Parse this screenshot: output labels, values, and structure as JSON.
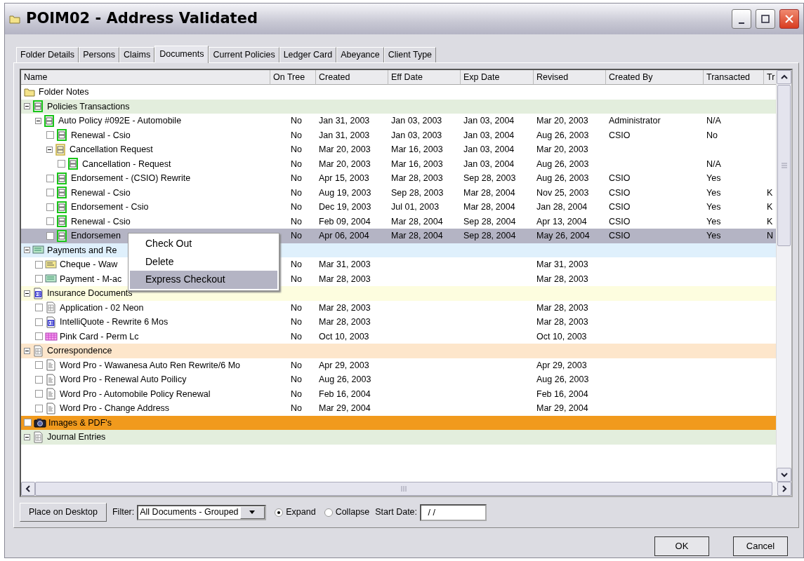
{
  "window": {
    "title": "POIM02 - Address Validated"
  },
  "tabs": [
    {
      "label": "Folder Details",
      "selected": false
    },
    {
      "label": "Persons",
      "selected": false
    },
    {
      "label": "Claims",
      "selected": false
    },
    {
      "label": "Documents",
      "selected": true
    },
    {
      "label": "Current Policies",
      "selected": false
    },
    {
      "label": "Ledger Card",
      "selected": false
    },
    {
      "label": "Abeyance",
      "selected": false
    },
    {
      "label": "Client Type",
      "selected": false
    }
  ],
  "table": {
    "columns": [
      "Name",
      "On Tree",
      "Created",
      "Eff Date",
      "Exp Date",
      "Revised",
      "Created By",
      "Transacted",
      "Tr"
    ],
    "rows": [
      {
        "name": "Folder Notes",
        "kind": "folder",
        "selected": false
      },
      {
        "name": "Policies Transactions",
        "kind": "green-form",
        "expanded": true,
        "color": "#e3eedd",
        "selected": false,
        "children": [
          {
            "name": "Auto Policy #092E        - Automobile",
            "kind": "green-form",
            "expanded": true,
            "selected": false,
            "cells": [
              "No",
              "Jan 31, 2003",
              "Jan 03, 2003",
              "Jan 03, 2004",
              "Mar 20, 2003",
              "Administrator",
              "N/A"
            ],
            "children": [
              {
                "name": "Renewal - Csio",
                "kind": "green-form",
                "checked": false,
                "selected": false,
                "cells": [
                  "No",
                  "Jan 31, 2003",
                  "Jan 03, 2003",
                  "Jan 03, 2004",
                  "Aug 26, 2003",
                  "CSIO",
                  "No"
                ]
              },
              {
                "name": "Cancellation Request",
                "kind": "yellow-form",
                "expanded": true,
                "selected": false,
                "cells": [
                  "No",
                  "Mar 20, 2003",
                  "Mar 16, 2003",
                  "Jan 03, 2004",
                  "Mar 20, 2003"
                ],
                "children": [
                  {
                    "name": "Cancellation - Request",
                    "kind": "green-form",
                    "checked": false,
                    "selected": false,
                    "cells": [
                      "No",
                      "Mar 20, 2003",
                      "Mar 16, 2003",
                      "Jan 03, 2004",
                      "Aug 26, 2003",
                      null,
                      "N/A"
                    ]
                  }
                ]
              },
              {
                "name": "Endorsement - (CSIO) Rewrite",
                "kind": "green-form",
                "checked": false,
                "selected": false,
                "cells": [
                  "No",
                  "Apr 15, 2003",
                  "Mar 28, 2003",
                  "Sep 28, 2003",
                  "Aug 26, 2003",
                  "CSIO",
                  "Yes"
                ]
              },
              {
                "name": "Renewal - Csio",
                "kind": "green-form",
                "checked": false,
                "selected": false,
                "cells": [
                  "No",
                  "Aug 19, 2003",
                  "Sep 28, 2003",
                  "Mar 28, 2004",
                  "Nov 25, 2003",
                  "CSIO",
                  "Yes",
                  "K"
                ]
              },
              {
                "name": "Endorsement - Csio",
                "kind": "green-form",
                "checked": false,
                "selected": false,
                "cells": [
                  "No",
                  "Dec 19, 2003",
                  "Jul 01, 2003",
                  "Mar 28, 2004",
                  "Jan 28, 2004",
                  "CSIO",
                  "Yes",
                  "K"
                ]
              },
              {
                "name": "Renewal - Csio",
                "kind": "green-form",
                "checked": false,
                "selected": false,
                "cells": [
                  "No",
                  "Feb 09, 2004",
                  "Mar 28, 2004",
                  "Sep 28, 2004",
                  "Apr 13, 2004",
                  "CSIO",
                  "Yes",
                  "K"
                ]
              },
              {
                "name": "Endorsemen",
                "kind": "green-form",
                "checked": false,
                "selected": true,
                "cells": [
                  "No",
                  "Apr 06, 2004",
                  "Mar 28, 2004",
                  "Sep 28, 2004",
                  "May 26, 2004",
                  "CSIO",
                  "Yes",
                  "N"
                ]
              }
            ]
          }
        ]
      },
      {
        "name": "Payments and Re",
        "kind": "green-card",
        "expanded": true,
        "color": "#dff0fc",
        "selected": false,
        "children": [
          {
            "name": "Cheque - Waw",
            "kind": "yellow-card",
            "checked": false,
            "selected": false,
            "cells": [
              "No",
              "Mar 31, 2003",
              null,
              null,
              "Mar 31, 2003"
            ]
          },
          {
            "name": "Payment - M-ac",
            "kind": "green-card",
            "checked": false,
            "selected": false,
            "cells": [
              "No",
              "Mar 28, 2003",
              null,
              null,
              "Mar 28, 2003"
            ]
          }
        ]
      },
      {
        "name": "Insurance Documents",
        "kind": "quote-doc",
        "expanded": true,
        "color": "#fdfddf",
        "selected": false,
        "children": [
          {
            "name": "Application - 02 Neon",
            "kind": "grid-doc",
            "checked": false,
            "selected": false,
            "cells": [
              "No",
              "Mar 28, 2003",
              null,
              null,
              "Mar 28, 2003"
            ]
          },
          {
            "name": "IntelliQuote - Rewrite 6 Mos",
            "kind": "quote-doc",
            "checked": false,
            "selected": false,
            "cells": [
              "No",
              "Mar 28, 2003",
              null,
              null,
              "Mar 28, 2003"
            ]
          },
          {
            "name": "Pink Card - Perm Lc",
            "kind": "pink-card",
            "checked": false,
            "selected": false,
            "cells": [
              "No",
              "Oct 10, 2003",
              null,
              null,
              "Oct 10, 2003"
            ]
          }
        ]
      },
      {
        "name": "Correspondence",
        "kind": "grid-doc",
        "expanded": true,
        "color": "#fde6cb",
        "selected": false,
        "children": [
          {
            "name": "Word Pro - Wawanesa Auto Ren Rewrite/6 Mo",
            "kind": "text-doc",
            "checked": false,
            "selected": false,
            "cells": [
              "No",
              "Apr 29, 2003",
              null,
              null,
              "Apr 29, 2003"
            ]
          },
          {
            "name": "Word Pro - Renewal Auto Poilicy",
            "kind": "text-doc",
            "checked": false,
            "selected": false,
            "cells": [
              "No",
              "Aug 26, 2003",
              null,
              null,
              "Aug 26, 2003"
            ]
          },
          {
            "name": "Word Pro - Automobile Policy Renewal",
            "kind": "text-doc",
            "checked": false,
            "selected": false,
            "cells": [
              "No",
              "Feb 16, 2004",
              null,
              null,
              "Feb 16, 2004"
            ]
          },
          {
            "name": "Word Pro - Change Address",
            "kind": "text-doc",
            "checked": false,
            "selected": false,
            "cells": [
              "No",
              "Mar 29, 2004",
              null,
              null,
              "Mar 29, 2004"
            ]
          }
        ]
      },
      {
        "name": "Images & PDF's",
        "kind": "camera",
        "checked": false,
        "color": "#f19a1d",
        "selected": false
      },
      {
        "name": "Journal Entries",
        "kind": "grid-doc",
        "expanded": true,
        "color": "#e3eedd",
        "selected": false
      }
    ]
  },
  "context_menu": {
    "items": [
      {
        "label": "Check Out",
        "selected": false
      },
      {
        "label": "Delete",
        "selected": false
      },
      {
        "label": "Express Checkout",
        "selected": true
      }
    ]
  },
  "toolbar": {
    "place_button": "Place on Desktop",
    "filter_label": "Filter:",
    "filter_value": "All Documents - Grouped",
    "view_options": [
      {
        "label": "Expand",
        "selected": true
      },
      {
        "label": "Collapse",
        "selected": false
      }
    ],
    "start_date_label": "Start Date:",
    "start_date_value": " / /"
  },
  "buttons": [
    "OK",
    "Cancel"
  ]
}
